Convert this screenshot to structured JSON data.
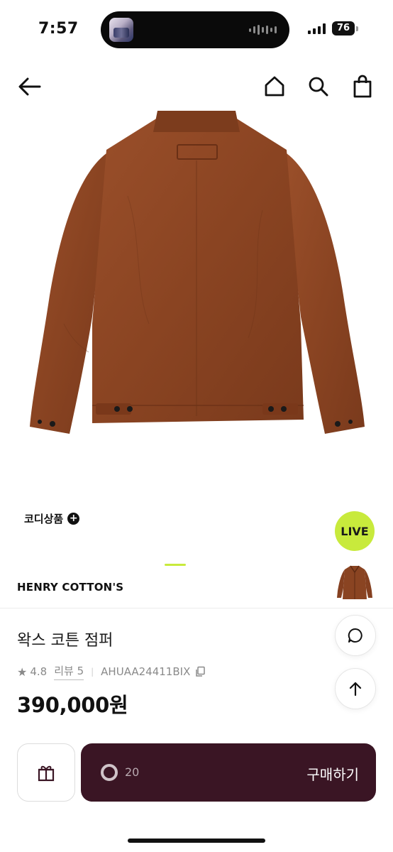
{
  "status_bar": {
    "time": "7:57",
    "battery": "76"
  },
  "codi": {
    "label": "코디상품",
    "plus": "+"
  },
  "live": {
    "label": "LIVE"
  },
  "product": {
    "brand": "HENRY COTTON'S",
    "title": "왁스 코튼 점퍼",
    "rating": "4.8",
    "review_label": "리뷰 5",
    "sku": "AHUAA24411BIX",
    "price": "390,000원",
    "color": "#8a4422"
  },
  "purchase": {
    "count": "20",
    "buy_label": "구매하기"
  },
  "colors": {
    "accent": "#c8ea3c",
    "buy_bg": "#3a1524"
  },
  "icons": [
    "back-arrow-icon",
    "home-icon",
    "search-icon",
    "shopping-bag-icon",
    "chat-bubble-icon",
    "arrow-up-icon",
    "gift-icon",
    "star-icon",
    "copy-icon"
  ]
}
